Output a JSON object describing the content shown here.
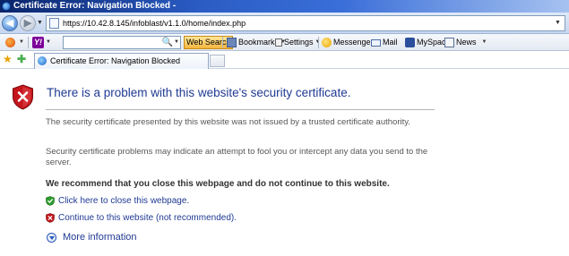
{
  "window": {
    "title": "Certificate Error: Navigation Blocked -"
  },
  "address_bar": {
    "url": "https://10.42.8.145/infoblast/v1.1.0/home/index.php"
  },
  "toolbar": {
    "web_search_label": "Web Search",
    "bookmarks_label": "Bookmarks",
    "settings_label": "Settings",
    "messenger_label": "Messenger",
    "mail_label": "Mail",
    "myspace_label": "MySpace",
    "news_label": "News",
    "yahoo_logo_text": "Y!"
  },
  "tabs": [
    {
      "label": "Certificate Error: Navigation Blocked"
    }
  ],
  "content": {
    "heading": "There is a problem with this website's security certificate.",
    "paragraph1": "The security certificate presented by this website was not issued by a trusted certificate authority.",
    "paragraph2": "Security certificate problems may indicate an attempt to fool you or intercept any data you send to the server.",
    "recommendation": "We recommend that you close this webpage and do not continue to this website.",
    "close_link": "Click here to close this webpage.",
    "continue_link": "Continue to this website (not recommended).",
    "more_info": "More information"
  },
  "icons": {
    "shield": "security-shield-x-icon",
    "close_option": "green-shield-check-icon",
    "continue_option": "red-shield-x-icon",
    "more_info": "expand-circle-icon"
  },
  "colors": {
    "title_bar": "#0a246a",
    "link": "#1f3a93",
    "shield_red": "#c4161c",
    "shield_green": "#2e9b2e"
  }
}
